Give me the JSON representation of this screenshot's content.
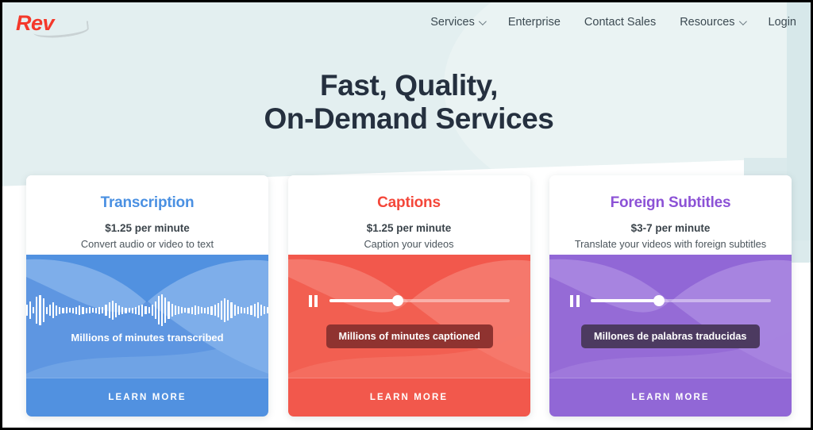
{
  "brand": {
    "logo_text": "Rev",
    "logo_color": "#f4382a"
  },
  "nav": {
    "items": [
      {
        "label": "Services",
        "has_chevron": true
      },
      {
        "label": "Enterprise",
        "has_chevron": false
      },
      {
        "label": "Contact Sales",
        "has_chevron": false
      },
      {
        "label": "Resources",
        "has_chevron": true
      },
      {
        "label": "Login",
        "has_chevron": false
      }
    ]
  },
  "hero": {
    "headline_line1": "Fast, Quality,",
    "headline_line2": "On-Demand Services",
    "bg_color": "#e3eff0",
    "text_color": "#25303f"
  },
  "cards": [
    {
      "id": "transcription",
      "title": "Transcription",
      "title_color": "#4a90e2",
      "price": "$1.25 per minute",
      "description": "Convert audio or video to text",
      "overlay_label": "Millions of minutes transcribed",
      "cta": "LEARN MORE",
      "accent": "#5191e0",
      "accent_light": "#7eaeea",
      "accent_dark": "#4484d8",
      "visual": "waveform"
    },
    {
      "id": "captions",
      "title": "Captions",
      "title_color": "#f4473a",
      "price": "$1.25 per minute",
      "description": "Caption your videos",
      "overlay_label": "Millions of minutes captioned",
      "cta": "LEARN MORE",
      "accent": "#f2584c",
      "accent_light": "#f5786c",
      "accent_dark": "#ef4a3c",
      "box_color": "#8f3330",
      "visual": "player",
      "slider_percent": 38
    },
    {
      "id": "foreign-subtitles",
      "title": "Foreign Subtitles",
      "title_color": "#8c52d6",
      "price": "$3-7 per minute",
      "description": "Translate your videos with foreign subtitles",
      "overlay_label": "Millones de palabras traducidas",
      "cta": "LEARN MORE",
      "accent": "#9167d6",
      "accent_light": "#a784e0",
      "accent_dark": "#8658ce",
      "box_color": "#4c3a60",
      "visual": "player",
      "slider_percent": 38
    }
  ],
  "waveform_heights": [
    14,
    22,
    8,
    34,
    38,
    30,
    9,
    14,
    20,
    13,
    9,
    7,
    8,
    6,
    7,
    9,
    12,
    9,
    7,
    8,
    6,
    7,
    9,
    8,
    14,
    20,
    24,
    18,
    12,
    9,
    7,
    6,
    7,
    9,
    12,
    15,
    10,
    8,
    14,
    22,
    36,
    40,
    32,
    22,
    16,
    12,
    10,
    8,
    6,
    7,
    9,
    12,
    10,
    8,
    7,
    9,
    11,
    14,
    18,
    24,
    30,
    26,
    20,
    14,
    10,
    8,
    7,
    9,
    12,
    16,
    20,
    14,
    10,
    8
  ]
}
